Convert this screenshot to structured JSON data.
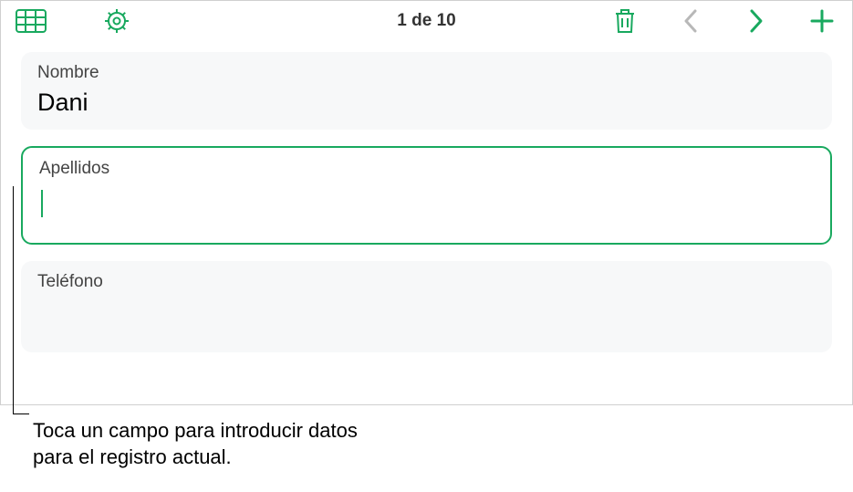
{
  "toolbar": {
    "counter": "1 de 10"
  },
  "fields": {
    "nombre": {
      "label": "Nombre",
      "value": "Dani"
    },
    "apellidos": {
      "label": "Apellidos",
      "value": ""
    },
    "telefono": {
      "label": "Teléfono",
      "value": ""
    }
  },
  "caption": "Toca un campo para introducir datos para el registro actual.",
  "colors": {
    "accent": "#19a95f"
  },
  "icons": {
    "table": "table-icon",
    "gear": "gear-icon",
    "trash": "trash-icon",
    "prev": "chevron-left-icon",
    "next": "chevron-right-icon",
    "add": "plus-icon"
  }
}
